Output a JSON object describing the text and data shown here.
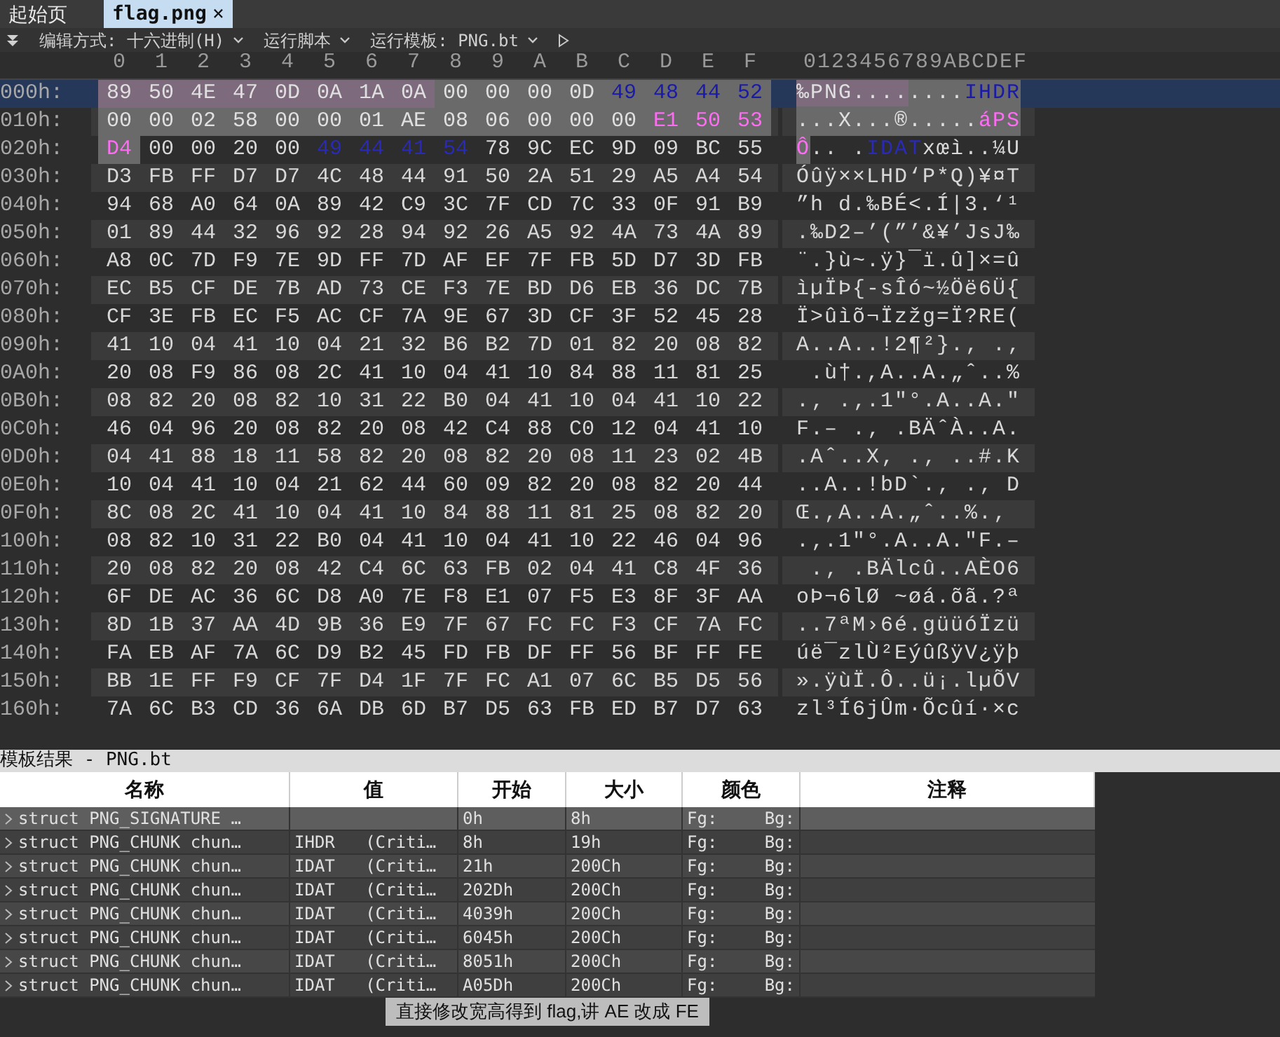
{
  "tabs": [
    {
      "label": "起始页",
      "selected": false
    },
    {
      "label": "flag.png",
      "selected": true,
      "close": "×"
    }
  ],
  "toolbar": {
    "items": [
      {
        "label": "编辑方式: 十六进制(H)",
        "dropdown": true
      },
      {
        "label": "运行脚本",
        "dropdown": true
      },
      {
        "label": "运行模板: PNG.bt",
        "dropdown": true
      }
    ]
  },
  "hex": {
    "columns": [
      "0",
      "1",
      "2",
      "3",
      "4",
      "5",
      "6",
      "7",
      "8",
      "9",
      "A",
      "B",
      "C",
      "D",
      "E",
      "F"
    ],
    "ascii_header": "0123456789ABCDEF",
    "rows": [
      {
        "offset": "000h:",
        "selected": true,
        "segments": [
          {
            "kind": "signature",
            "bytes": "89 50 4E 47 0D 0A 1A 0A",
            "ascii": "‰PNG...."
          },
          {
            "kind": "chunk",
            "bytes": "00 00 00 0D",
            "ascii": "...."
          },
          {
            "kind": "chunk-type",
            "bytes": "49 48 44 52",
            "ascii": "IHDR"
          }
        ]
      },
      {
        "offset": "010h:",
        "selected": false,
        "segments": [
          {
            "kind": "chunk",
            "bytes": "00 00 02 58 00 00 01 AE 08 06 00 00 00",
            "ascii": "...X...®....."
          },
          {
            "kind": "crc",
            "bytes": "E1 50 53",
            "ascii": "áPS"
          }
        ]
      },
      {
        "offset": "020h:",
        "selected": false,
        "segments": [
          {
            "kind": "crc",
            "bytes": "D4",
            "ascii": "Ô"
          },
          {
            "kind": "plain",
            "bytes": "00 00 20 00",
            "ascii": ".. ."
          },
          {
            "kind": "type",
            "bytes": "49 44 41 54",
            "ascii": "IDAT"
          },
          {
            "kind": "plain",
            "bytes": "78 9C EC 9D 09 BC 55",
            "ascii": "xœì..¼U"
          }
        ]
      },
      {
        "offset": "030h:",
        "selected": false,
        "segments": [
          {
            "kind": "plain",
            "bytes": "D3 FB FF D7 D7 4C 48 44 91 50 2A 51 29 A5 A4 54",
            "ascii": "Óûÿ××LHD‘P*Q)¥¤T"
          }
        ]
      },
      {
        "offset": "040h:",
        "selected": false,
        "segments": [
          {
            "kind": "plain",
            "bytes": "94 68 A0 64 0A 89 42 C9 3C 7F CD 7C 33 0F 91 B9",
            "ascii": "”h d.‰BÉ<.Í|3.‘¹"
          }
        ]
      },
      {
        "offset": "050h:",
        "selected": false,
        "segments": [
          {
            "kind": "plain",
            "bytes": "01 89 44 32 96 92 28 94 92 26 A5 92 4A 73 4A 89",
            "ascii": ".‰D2–’(”’&¥’JsJ‰"
          }
        ]
      },
      {
        "offset": "060h:",
        "selected": false,
        "segments": [
          {
            "kind": "plain",
            "bytes": "A8 0C 7D F9 7E 9D FF 7D AF EF 7F FB 5D D7 3D FB",
            "ascii": "¨.}ù~.ÿ}¯ï.û]×=û"
          }
        ]
      },
      {
        "offset": "070h:",
        "selected": false,
        "segments": [
          {
            "kind": "plain",
            "bytes": "EC B5 CF DE 7B AD 73 CE F3 7E BD D6 EB 36 DC 7B",
            "ascii": "ìµÏÞ{-sÎó~½Öë6Ü{"
          }
        ]
      },
      {
        "offset": "080h:",
        "selected": false,
        "segments": [
          {
            "kind": "plain",
            "bytes": "CF 3E FB EC F5 AC CF 7A 9E 67 3D CF 3F 52 45 28",
            "ascii": "Ï>ûìõ¬Ïzžg=Ï?RE("
          }
        ]
      },
      {
        "offset": "090h:",
        "selected": false,
        "segments": [
          {
            "kind": "plain",
            "bytes": "41 10 04 41 10 04 21 32 B6 B2 7D 01 82 20 08 82",
            "ascii": "A..A..!2¶²}.‚ .‚"
          }
        ]
      },
      {
        "offset": "0A0h:",
        "selected": false,
        "segments": [
          {
            "kind": "plain",
            "bytes": "20 08 F9 86 08 2C 41 10 04 41 10 84 88 11 81 25",
            "ascii": " .ù†.,A..A.„ˆ..%"
          }
        ]
      },
      {
        "offset": "0B0h:",
        "selected": false,
        "segments": [
          {
            "kind": "plain",
            "bytes": "08 82 20 08 82 10 31 22 B0 04 41 10 04 41 10 22",
            "ascii": ".‚ .‚.1\"°.A..A.\""
          }
        ]
      },
      {
        "offset": "0C0h:",
        "selected": false,
        "segments": [
          {
            "kind": "plain",
            "bytes": "46 04 96 20 08 82 20 08 42 C4 88 C0 12 04 41 10",
            "ascii": "F.– .‚ .BÄˆÀ..A."
          }
        ]
      },
      {
        "offset": "0D0h:",
        "selected": false,
        "segments": [
          {
            "kind": "plain",
            "bytes": "04 41 88 18 11 58 82 20 08 82 20 08 11 23 02 4B",
            "ascii": ".Aˆ..X‚ .‚ ..#.K"
          }
        ]
      },
      {
        "offset": "0E0h:",
        "selected": false,
        "segments": [
          {
            "kind": "plain",
            "bytes": "10 04 41 10 04 21 62 44 60 09 82 20 08 82 20 44",
            "ascii": "..A..!bD`.‚ .‚ D"
          }
        ]
      },
      {
        "offset": "0F0h:",
        "selected": false,
        "segments": [
          {
            "kind": "plain",
            "bytes": "8C 08 2C 41 10 04 41 10 84 88 11 81 25 08 82 20",
            "ascii": "Œ.,A..A.„ˆ..%.‚"
          }
        ]
      },
      {
        "offset": "100h:",
        "selected": false,
        "segments": [
          {
            "kind": "plain",
            "bytes": "08 82 10 31 22 B0 04 41 10 04 41 10 22 46 04 96",
            "ascii": ".‚.1\"°.A..A.\"F.–"
          }
        ]
      },
      {
        "offset": "110h:",
        "selected": false,
        "segments": [
          {
            "kind": "plain",
            "bytes": "20 08 82 20 08 42 C4 6C 63 FB 02 04 41 C8 4F 36",
            "ascii": " .‚ .BÄlcû..AÈO6"
          }
        ]
      },
      {
        "offset": "120h:",
        "selected": false,
        "segments": [
          {
            "kind": "plain",
            "bytes": "6F DE AC 36 6C D8 A0 7E F8 E1 07 F5 E3 8F 3F AA",
            "ascii": "oÞ¬6lØ ~øá.õã.?ª"
          }
        ]
      },
      {
        "offset": "130h:",
        "selected": false,
        "segments": [
          {
            "kind": "plain",
            "bytes": "8D 1B 37 AA 4D 9B 36 E9 7F 67 FC FC F3 CF 7A FC",
            "ascii": "..7ªM›6é.güüóÏzü"
          }
        ]
      },
      {
        "offset": "140h:",
        "selected": false,
        "segments": [
          {
            "kind": "plain",
            "bytes": "FA EB AF 7A 6C D9 B2 45 FD FB DF FF 56 BF FF FE",
            "ascii": "úë¯zlÙ²EýûßÿV¿ÿþ"
          }
        ]
      },
      {
        "offset": "150h:",
        "selected": false,
        "segments": [
          {
            "kind": "plain",
            "bytes": "BB 1E FF F9 CF 7F D4 1F 7F FC A1 07 6C B5 D5 56",
            "ascii": "».ÿùÏ.Ô..ü¡.lµÕV"
          }
        ]
      },
      {
        "offset": "160h:",
        "selected": false,
        "segments": [
          {
            "kind": "plain",
            "bytes": "7A 6C B3 CD 36 6A DB 6D B7 D5 63 FB ED B7 D7 63",
            "ascii": "zl³Í6jÛm·Õcûí·×c"
          }
        ]
      }
    ]
  },
  "template": {
    "title": "模板结果 - PNG.bt",
    "columns": [
      "名称",
      "值",
      "开始",
      "大小",
      "颜色",
      "注释"
    ],
    "rows": [
      {
        "selected": true,
        "name": "struct PNG_SIGNATURE …",
        "value": "",
        "start": "0h",
        "size": "8h",
        "fg": "Fg:",
        "bg": "Bg:"
      },
      {
        "selected": false,
        "name": "struct PNG_CHUNK chun…",
        "value": "IHDR   (Criti…",
        "start": "8h",
        "size": "19h",
        "fg": "Fg:",
        "bg": "Bg:"
      },
      {
        "selected": false,
        "name": "struct PNG_CHUNK chun…",
        "value": "IDAT   (Criti…",
        "start": "21h",
        "size": "200Ch",
        "fg": "Fg:",
        "bg": "Bg:"
      },
      {
        "selected": false,
        "name": "struct PNG_CHUNK chun…",
        "value": "IDAT   (Criti…",
        "start": "202Dh",
        "size": "200Ch",
        "fg": "Fg:",
        "bg": "Bg:"
      },
      {
        "selected": false,
        "name": "struct PNG_CHUNK chun…",
        "value": "IDAT   (Criti…",
        "start": "4039h",
        "size": "200Ch",
        "fg": "Fg:",
        "bg": "Bg:"
      },
      {
        "selected": false,
        "name": "struct PNG_CHUNK chun…",
        "value": "IDAT   (Criti…",
        "start": "6045h",
        "size": "200Ch",
        "fg": "Fg:",
        "bg": "Bg:"
      },
      {
        "selected": false,
        "name": "struct PNG_CHUNK chun…",
        "value": "IDAT   (Criti…",
        "start": "8051h",
        "size": "200Ch",
        "fg": "Fg:",
        "bg": "Bg:"
      },
      {
        "selected": false,
        "name": "struct PNG_CHUNK chun…",
        "value": "IDAT   (Criti…",
        "start": "A05Dh",
        "size": "200Ch",
        "fg": "Fg:",
        "bg": "Bg:"
      }
    ]
  },
  "caption": "直接修改宽高得到 flag,讲 AE 改成 FE"
}
